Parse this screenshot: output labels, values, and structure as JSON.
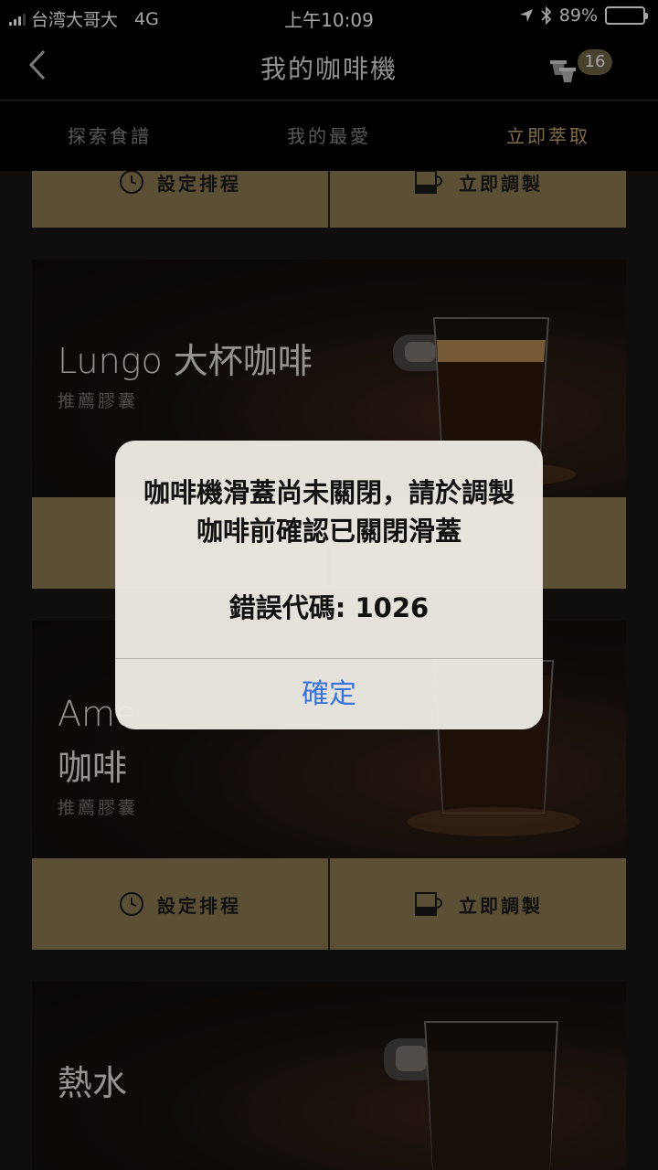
{
  "status_bar": {
    "carrier": "台湾大哥大",
    "network": "4G",
    "time": "上午10:09",
    "battery": "89%",
    "battery_level": 0.89,
    "icons": [
      "location-arrow-icon",
      "bluetooth-icon",
      "battery-icon"
    ]
  },
  "nav": {
    "title": "我的咖啡機",
    "capsule_count": "16",
    "back_icon": "chevron-left-icon"
  },
  "tabs": [
    {
      "label": "探索食譜",
      "active": false
    },
    {
      "label": "我的最愛",
      "active": false
    },
    {
      "label": "立即萃取",
      "active": true
    }
  ],
  "buttons": {
    "schedule": "設定排程",
    "brew_now": "立即調製"
  },
  "cards": [
    {
      "title": "Lungo 大杯咖啡",
      "subtitle": "推薦膠囊"
    },
    {
      "title_line1": "Ame",
      "title_line2": "咖啡",
      "subtitle": "推薦膠囊"
    },
    {
      "title": "熱水"
    }
  ],
  "alert": {
    "message": "咖啡機滑蓋尚未關閉，請於調製咖啡前確認已關閉滑蓋",
    "error_code": "錯誤代碼: 1026",
    "confirm": "確定"
  },
  "colors": {
    "accent": "#c6a96d",
    "button_bg": "#8c7a52",
    "link_blue": "#3a73d9"
  }
}
